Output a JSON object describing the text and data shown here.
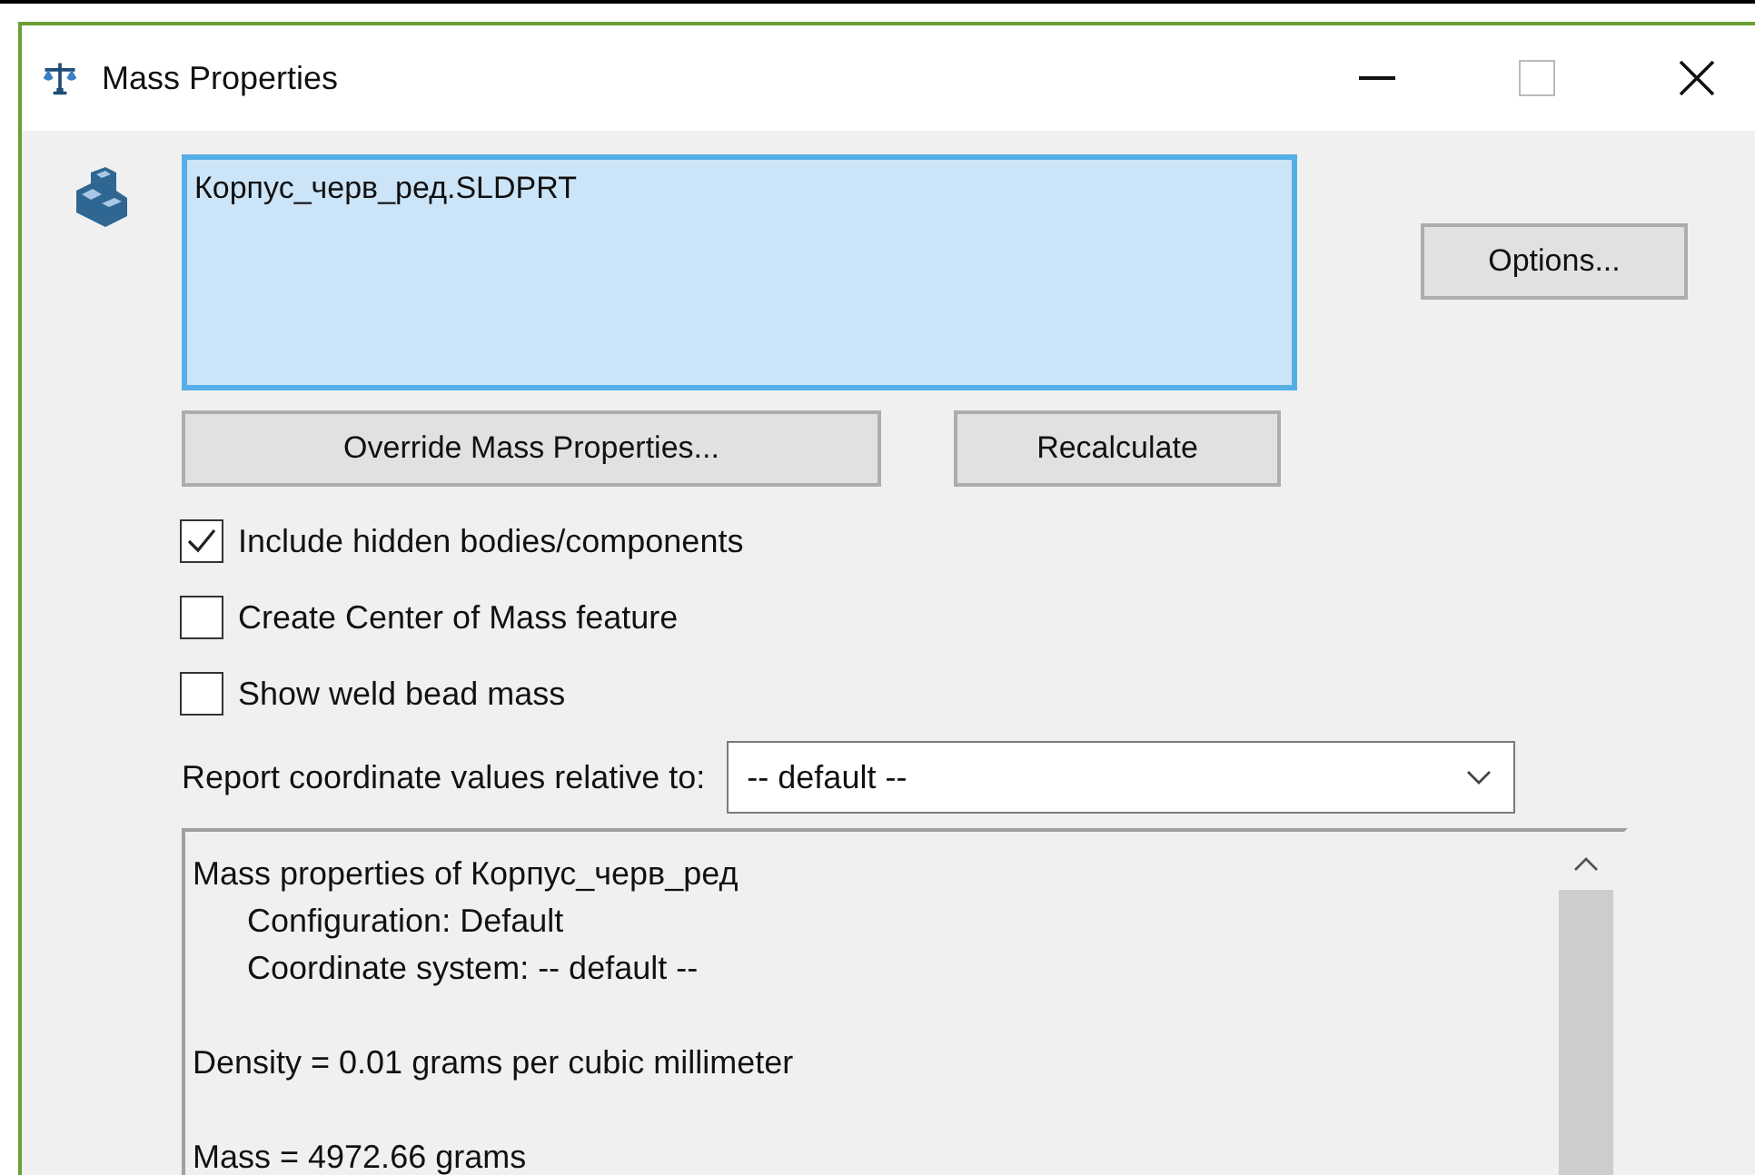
{
  "window": {
    "title": "Mass Properties"
  },
  "selection_list": {
    "items": [
      {
        "label": "Корпус_черв_ред.SLDPRT",
        "selected": true
      }
    ]
  },
  "buttons": {
    "options": "Options...",
    "override": "Override Mass Properties...",
    "recalculate": "Recalculate"
  },
  "checkboxes": [
    {
      "label": "Include hidden bodies/components",
      "checked": true
    },
    {
      "label": "Create Center of Mass feature",
      "checked": false
    },
    {
      "label": "Show weld bead mass",
      "checked": false
    }
  ],
  "coordinate_system": {
    "label": "Report coordinate values relative to:",
    "value": "-- default --"
  },
  "report": {
    "groups": [
      {
        "text": "Mass properties of Корпус_черв_ред",
        "children": [
          {
            "text": "Configuration: Default"
          },
          {
            "text": "Coordinate system: -- default --"
          }
        ]
      },
      {
        "text": "Density = 0.01 grams per cubic millimeter"
      },
      {
        "text": "Mass = 4972.66 grams"
      }
    ]
  }
}
